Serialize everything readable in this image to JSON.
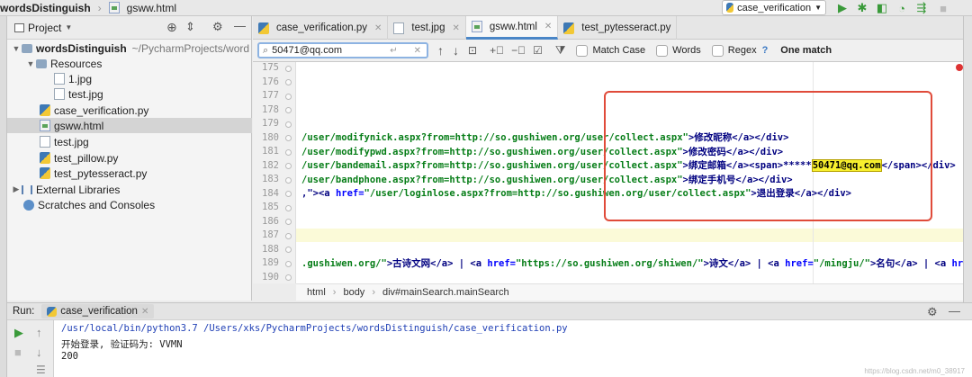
{
  "navbar": {
    "project_name": "wordsDistinguish",
    "file_name": "gsww.html",
    "run_config": "case_verification"
  },
  "project_panel": {
    "title": "Project",
    "root_label": "wordsDistinguish",
    "root_path": "~/PycharmProjects/word",
    "items": [
      {
        "label": "Resources"
      },
      {
        "label": "1.jpg"
      },
      {
        "label": "test.jpg"
      },
      {
        "label": "case_verification.py"
      },
      {
        "label": "gsww.html"
      },
      {
        "label": "test.jpg"
      },
      {
        "label": "test_pillow.py"
      },
      {
        "label": "test_pytesseract.py"
      },
      {
        "label": "External Libraries"
      },
      {
        "label": "Scratches and Consoles"
      }
    ]
  },
  "tabs": [
    {
      "label": "case_verification.py"
    },
    {
      "label": "test.jpg"
    },
    {
      "label": "gsww.html"
    },
    {
      "label": "test_pytesseract.py"
    }
  ],
  "search": {
    "query": "50471@qq.com",
    "match_case": "Match Case",
    "words": "Words",
    "regex": "Regex",
    "regex_help": "?",
    "result": "One match"
  },
  "editor": {
    "line_numbers": [
      "175",
      "176",
      "177",
      "178",
      "179",
      "180",
      "181",
      "182",
      "183",
      "184",
      "185",
      "186",
      "187",
      "188",
      "189",
      "190"
    ],
    "lines": {
      "l180a": "/user/modifynick.aspx?from=http://so.gushiwen.org/user/collect.aspx\"",
      "l180b": ">修改昵称</a></div>",
      "l181a": "/user/modifypwd.aspx?from=http://so.gushiwen.org/user/collect.aspx\"",
      "l181b": ">修改密码</a></div>",
      "l182a": "/user/bandemail.aspx?from=http://so.gushiwen.org/user/collect.aspx\"",
      "l182b": ">绑定邮箱</a><span>*****",
      "l182hl": "50471@qq.com",
      "l182c": "</span></div>",
      "l183a": "/user/bandphone.aspx?from=http://so.gushiwen.org/user/collect.aspx\"",
      "l183b": ">绑定手机号</a></div>",
      "l184a": ",\"><a ",
      "l184b": "href=",
      "l184c": "\"/user/loginlose.aspx?from=http://so.gushiwen.org/user/collect.aspx\"",
      "l184d": ">退出登录</a></div>",
      "l189a": ".gushiwen.org/\"",
      "l189b": ">古诗文网</a> | <a ",
      "l189c": "href=",
      "l189d": "\"https://so.gushiwen.org/shiwen/\"",
      "l189e": ">诗文</a> | <a ",
      "l189f": "href=",
      "l189g": "\"/mingju/\"",
      "l189h": ">名句</a> | <a ",
      "l189i": "href="
    }
  },
  "breadcrumb": [
    "html",
    "body",
    "div#mainSearch.mainSearch"
  ],
  "run": {
    "label": "Run:",
    "tab": "case_verification",
    "console": [
      "/usr/local/bin/python3.7 /Users/xks/PycharmProjects/wordsDistinguish/case_verification.py",
      "开始登录, 验证码为: VVMN",
      "200"
    ],
    "watermark": "https://blog.csdn.net/m0_38917"
  }
}
